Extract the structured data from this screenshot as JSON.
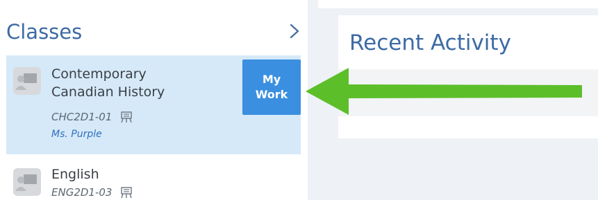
{
  "classes_section": {
    "title": "Classes",
    "expand_icon": "chevron-right-icon"
  },
  "classes": [
    {
      "name": "Contemporary Canadian History",
      "code": "CHC2D1-01",
      "teacher": "Ms. Purple",
      "button_label": "My Work",
      "selected": true
    },
    {
      "name": "English",
      "code": "ENG2D1-03",
      "selected": false
    }
  ],
  "recent_activity": {
    "title": "Recent Activity"
  },
  "colors": {
    "accent_blue": "#3a8fe0",
    "selected_bg": "#d6e9f8",
    "title_blue": "#3d6aa5",
    "arrow_green": "#5cbf2a"
  },
  "icons": [
    "class-icon",
    "room-icon",
    "arrow-icon"
  ]
}
